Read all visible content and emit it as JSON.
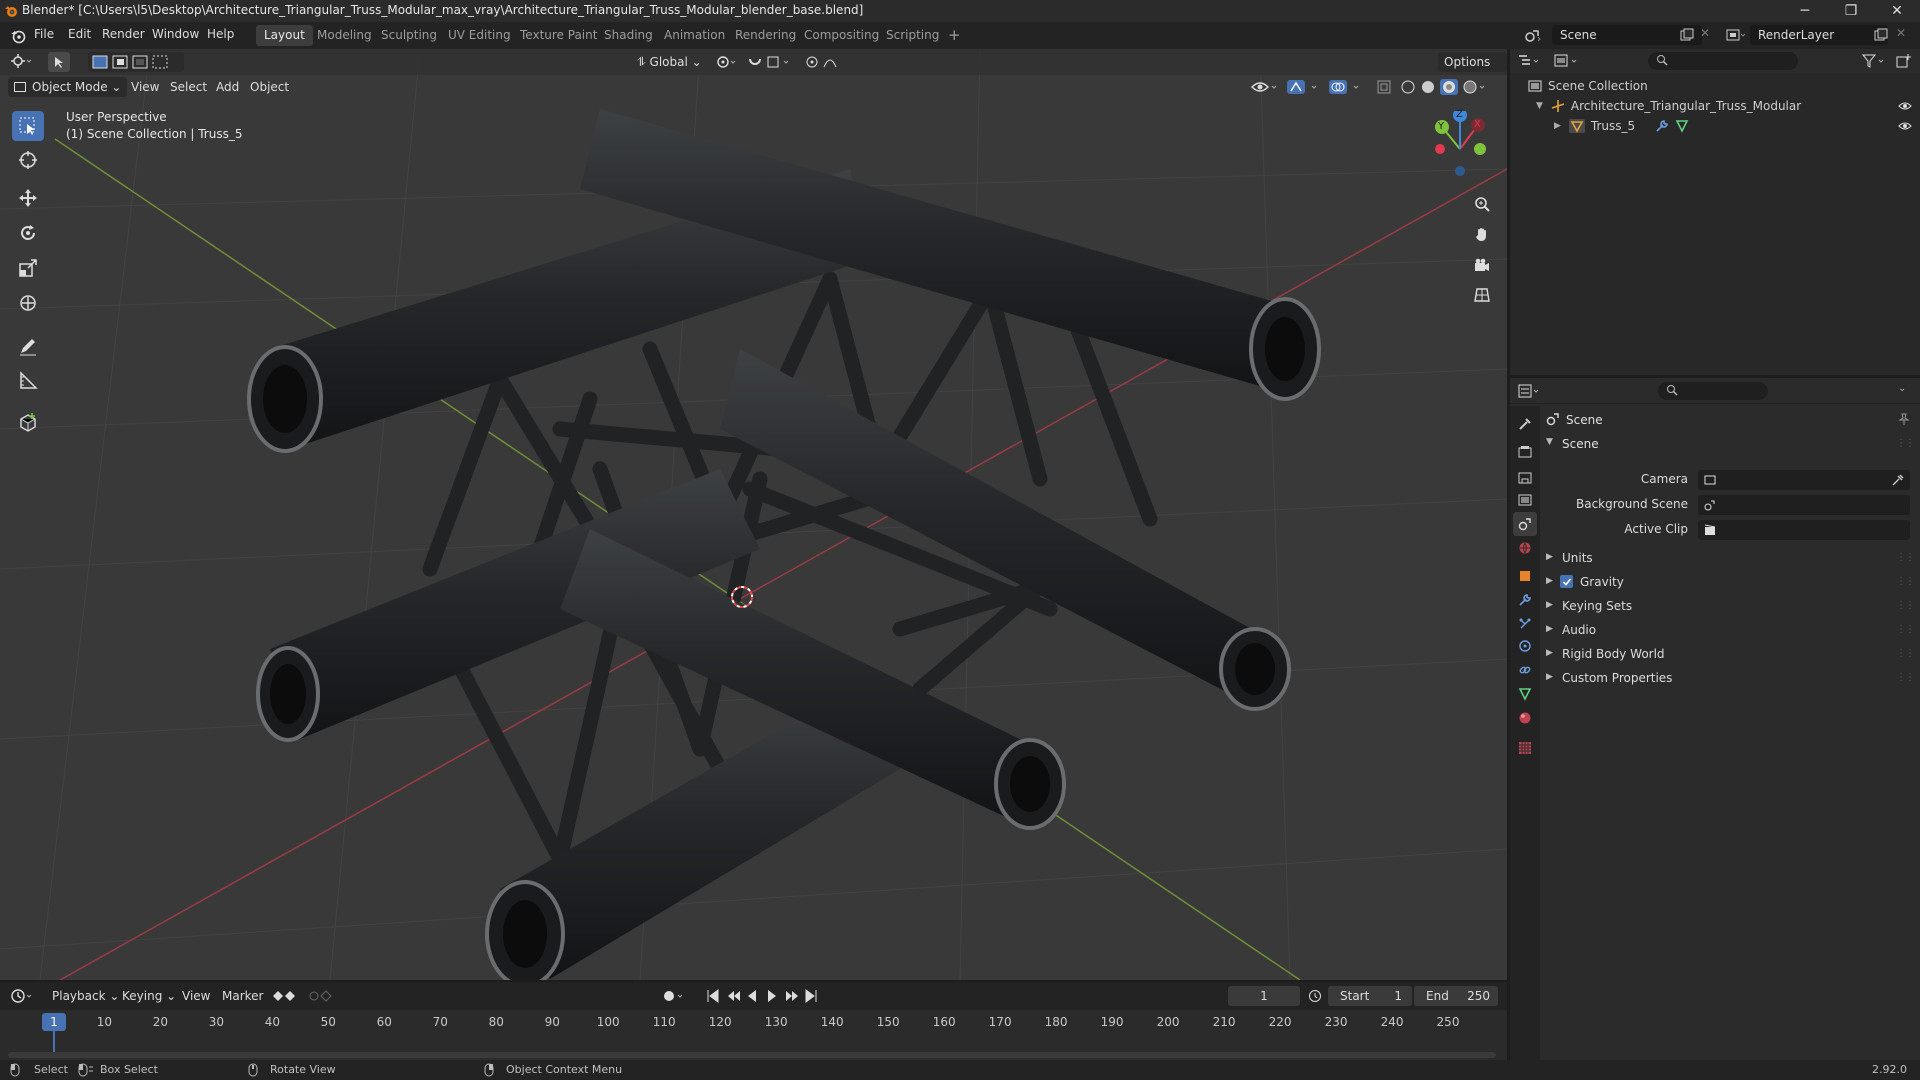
{
  "window": {
    "title": "Blender* [C:\\Users\\l5\\Desktop\\Architecture_Triangular_Truss_Modular_max_vray\\Architecture_Triangular_Truss_Modular_blender_base.blend]",
    "minimize": "─",
    "maximize": "❐",
    "close": "✕"
  },
  "menu": {
    "items": [
      "File",
      "Edit",
      "Render",
      "Window",
      "Help"
    ],
    "workspaces": [
      "Layout",
      "Modeling",
      "Sculpting",
      "UV Editing",
      "Texture Paint",
      "Shading",
      "Animation",
      "Rendering",
      "Compositing",
      "Scripting"
    ],
    "active_workspace": "Layout",
    "add_tab": "+",
    "scene_name": "Scene",
    "view_layer": "RenderLayer"
  },
  "viewport": {
    "mode": "Object Mode",
    "menus": [
      "View",
      "Select",
      "Add",
      "Object"
    ],
    "transform_orientation": "Global",
    "options_label": "Options",
    "overlay_line1": "User Perspective",
    "overlay_line2": "(1) Scene Collection | Truss_5",
    "axis_x": "X",
    "axis_y": "Y",
    "axis_z": "Z"
  },
  "outliner": {
    "root": "Scene Collection",
    "collection": "Architecture_Triangular_Truss_Modular",
    "object": "Truss_5"
  },
  "properties": {
    "header": "Scene",
    "panel": "Scene",
    "camera_label": "Camera",
    "background_scene_label": "Background Scene",
    "active_clip_label": "Active Clip",
    "subpanels": [
      "Units",
      "Gravity",
      "Keying Sets",
      "Audio",
      "Rigid Body World",
      "Custom Properties"
    ],
    "gravity_checked": true
  },
  "timeline": {
    "menus": [
      "Playback",
      "Keying",
      "View",
      "Marker"
    ],
    "current_frame": "1",
    "start_label": "Start",
    "start_value": "1",
    "end_label": "End",
    "end_value": "250",
    "ticks": [
      "1",
      "10",
      "20",
      "30",
      "40",
      "50",
      "60",
      "70",
      "80",
      "90",
      "100",
      "110",
      "120",
      "130",
      "140",
      "150",
      "160",
      "170",
      "180",
      "190",
      "200",
      "210",
      "220",
      "230",
      "240",
      "250"
    ]
  },
  "statusbar": {
    "select": "Select",
    "box_select": "Box Select",
    "rotate_view": "Rotate View",
    "context_menu": "Object Context Menu",
    "version": "2.92.0"
  },
  "colors": {
    "accent": "#4772b3",
    "axis_x": "#e23b4f",
    "axis_y": "#7fc33b",
    "axis_z": "#3b8ae0",
    "viewport_bg": "#393939",
    "panel_bg": "#2b2b2b"
  }
}
